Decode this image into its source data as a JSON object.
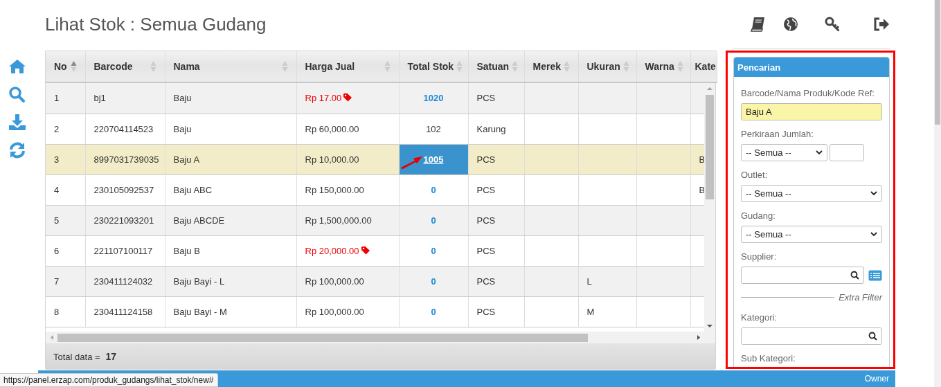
{
  "page_title": "Lihat Stok : Semua Gudang",
  "table": {
    "columns": [
      {
        "label": "No",
        "sorted": true
      },
      {
        "label": "Barcode",
        "sorted": false
      },
      {
        "label": "Nama",
        "sorted": false
      },
      {
        "label": "Harga Jual",
        "sorted": false
      },
      {
        "label": "Total Stok",
        "sorted": false
      },
      {
        "label": "Satuan",
        "sorted": false
      },
      {
        "label": "Merek",
        "sorted": false
      },
      {
        "label": "Ukuran",
        "sorted": false
      },
      {
        "label": "Warna",
        "sorted": false
      },
      {
        "label": "Kate"
      }
    ],
    "rows": [
      {
        "no": "1",
        "barcode": "bj1",
        "name": "Baju",
        "price": "Rp 17.00",
        "promo": true,
        "stock": "1020",
        "stock_link": true,
        "unit": "PCS",
        "selected": false
      },
      {
        "no": "2",
        "barcode": "220704114523",
        "name": "Baju",
        "price": "Rp 60,000.00",
        "promo": false,
        "stock": "102",
        "stock_link": false,
        "unit": "Karung",
        "selected": false
      },
      {
        "no": "3",
        "barcode": "8997031739035",
        "name": "Baju A",
        "price": "Rp 10,000.00",
        "promo": false,
        "stock": "1005",
        "stock_link": true,
        "unit": "PCS",
        "category": "B",
        "selected": true
      },
      {
        "no": "4",
        "barcode": "230105092537",
        "name": "Baju ABC",
        "price": "Rp 150,000.00",
        "promo": false,
        "stock": "0",
        "stock_link": true,
        "unit": "PCS",
        "category": "B",
        "selected": false
      },
      {
        "no": "5",
        "barcode": "230221093201",
        "name": "Baju ABCDE",
        "price": "Rp 1,500,000.00",
        "promo": false,
        "stock": "0",
        "stock_link": true,
        "unit": "PCS",
        "selected": false
      },
      {
        "no": "6",
        "barcode": "221107100117",
        "name": "Baju B",
        "price": "Rp 20,000.00",
        "promo": true,
        "stock": "0",
        "stock_link": true,
        "unit": "PCS",
        "selected": false
      },
      {
        "no": "7",
        "barcode": "230411124032",
        "name": "Baju Bayi - L",
        "price": "Rp 100,000.00",
        "promo": false,
        "stock": "0",
        "stock_link": true,
        "unit": "PCS",
        "size": "L",
        "selected": false
      },
      {
        "no": "8",
        "barcode": "230411124158",
        "name": "Baju Bayi - M",
        "price": "Rp 100,000.00",
        "promo": false,
        "stock": "0",
        "stock_link": true,
        "unit": "PCS",
        "size": "M",
        "selected": false
      }
    ],
    "footer": {
      "label": "Total data =",
      "value": "17"
    }
  },
  "search_panel": {
    "title": "Pencarian",
    "fields": [
      {
        "kind": "text",
        "label": "Barcode/Nama Produk/Kode Ref:",
        "value": "Baju A",
        "highlighted": true
      },
      {
        "kind": "select_qty",
        "label": "Perkiraan Jumlah:",
        "value": "-- Semua --"
      },
      {
        "kind": "select",
        "label": "Outlet:",
        "value": "-- Semua --"
      },
      {
        "kind": "select",
        "label": "Gudang:",
        "value": "-- Semua --"
      },
      {
        "kind": "lookup",
        "label": "Supplier:",
        "list_button": true
      },
      {
        "kind": "divider",
        "label": "Extra Filter"
      },
      {
        "kind": "lookup",
        "label": "Kategori:",
        "list_button": false
      },
      {
        "kind": "label",
        "label": "Sub Kategori:"
      }
    ]
  },
  "status_bar": {
    "user": "Owner"
  },
  "link_preview": {
    "url": "https://panel.erzap.com/produk_gudangs/lihat_stok/new#"
  }
}
